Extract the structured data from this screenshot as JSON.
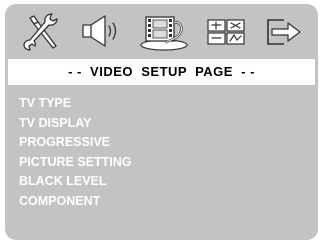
{
  "colors": {
    "panel": "#c3c3c3",
    "title_bar": "#ffffff",
    "title_text": "#000000",
    "menu_text": "#ffffff"
  },
  "icon_bar": {
    "tabs": [
      {
        "name": "general-setup",
        "icon": "tools-icon"
      },
      {
        "name": "audio-setup",
        "icon": "speaker-icon"
      },
      {
        "name": "video-setup",
        "icon": "film-reel-icon",
        "selected": true
      },
      {
        "name": "preference-setup",
        "icon": "preference-grid-icon"
      },
      {
        "name": "exit",
        "icon": "exit-arrow-icon"
      }
    ]
  },
  "page_title": "- -  VIDEO  SETUP  PAGE  - -",
  "menu": {
    "items": [
      {
        "label": "TV TYPE"
      },
      {
        "label": "TV DISPLAY"
      },
      {
        "label": "PROGRESSIVE"
      },
      {
        "label": "PICTURE SETTING"
      },
      {
        "label": "BLACK LEVEL"
      },
      {
        "label": "COMPONENT"
      }
    ]
  }
}
